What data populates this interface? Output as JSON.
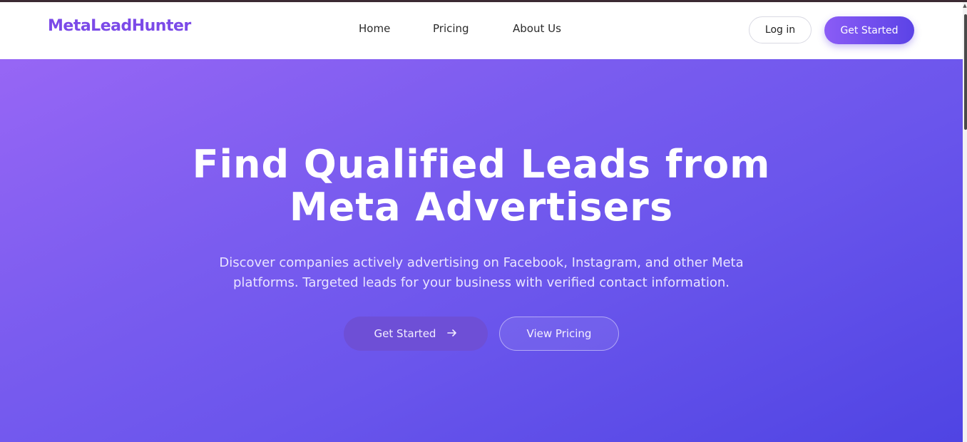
{
  "brand": {
    "logo_text": "MetaLeadHunter",
    "primary_color": "#7b4ae8",
    "gradient_start": "#9766f5",
    "gradient_end": "#4f44e3"
  },
  "nav": {
    "links": [
      {
        "label": "Home"
      },
      {
        "label": "Pricing"
      },
      {
        "label": "About Us"
      }
    ],
    "login_label": "Log in",
    "get_started_label": "Get Started"
  },
  "hero": {
    "title_line1": "Find Qualified Leads from",
    "title_line2": "Meta Advertisers",
    "subtitle_line1": "Discover companies actively advertising on Facebook, Instagram, and other Meta",
    "subtitle_line2": "platforms. Targeted leads for your business with verified contact information.",
    "primary_button_label": "Get Started",
    "primary_button_icon": "arrow-right-icon",
    "secondary_button_label": "View Pricing"
  }
}
